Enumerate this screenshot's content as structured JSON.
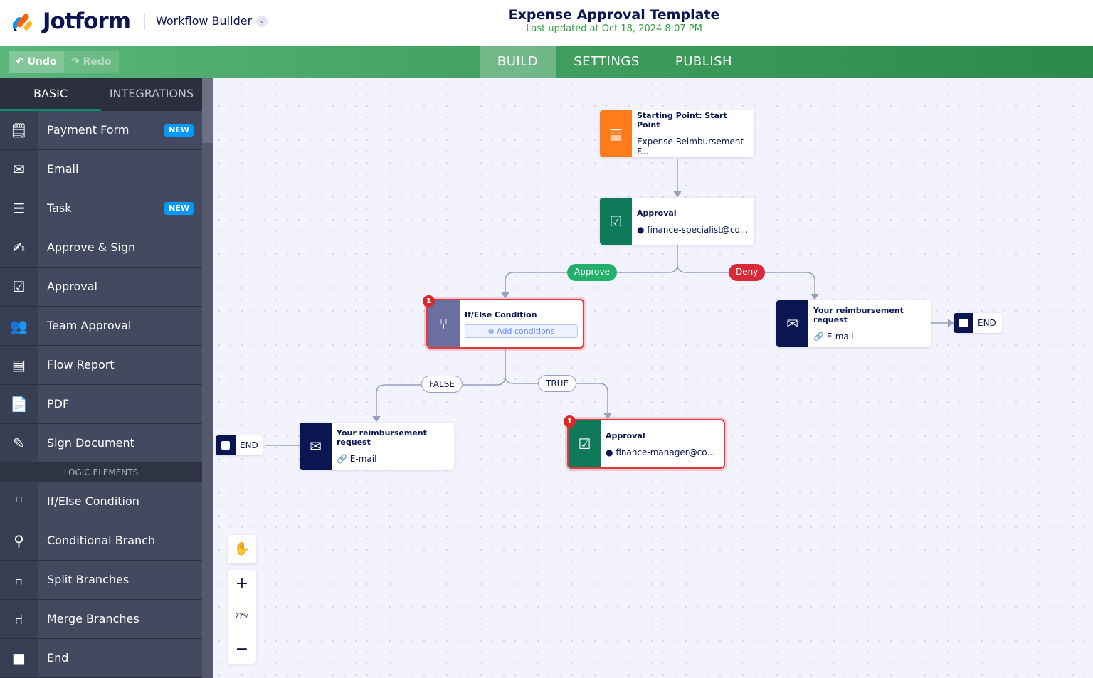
{
  "header": {
    "logo": "Jotform",
    "product": "Workflow Builder",
    "title": "Expense Approval Template",
    "updated": "Last updated at Oct 18, 2024 8:07 PM"
  },
  "toolbar": {
    "undo": "Undo",
    "redo": "Redo",
    "tabs": [
      "BUILD",
      "SETTINGS",
      "PUBLISH"
    ],
    "active_tab": "BUILD"
  },
  "sidebar": {
    "tabs": [
      "BASIC",
      "INTEGRATIONS"
    ],
    "active_tab": "BASIC",
    "items": [
      {
        "label": "Payment Form",
        "badge": "NEW",
        "icon": "payment-form-icon"
      },
      {
        "label": "Email",
        "icon": "email-icon"
      },
      {
        "label": "Task",
        "badge": "NEW",
        "icon": "task-icon"
      },
      {
        "label": "Approve & Sign",
        "icon": "approve-sign-icon"
      },
      {
        "label": "Approval",
        "icon": "approval-icon"
      },
      {
        "label": "Team Approval",
        "icon": "team-approval-icon"
      },
      {
        "label": "Flow Report",
        "icon": "flow-report-icon"
      },
      {
        "label": "PDF",
        "icon": "pdf-icon"
      },
      {
        "label": "Sign Document",
        "icon": "sign-document-icon"
      }
    ],
    "logic_header": "LOGIC ELEMENTS",
    "logic_items": [
      {
        "label": "If/Else Condition",
        "icon": "if-else-icon"
      },
      {
        "label": "Conditional Branch",
        "icon": "conditional-branch-icon"
      },
      {
        "label": "Split Branches",
        "icon": "split-branches-icon"
      },
      {
        "label": "Merge Branches",
        "icon": "merge-branches-icon"
      },
      {
        "label": "End",
        "icon": "end-icon"
      }
    ]
  },
  "canvas": {
    "start": {
      "title": "Starting Point: Start Point",
      "sub": "Expense Reimbursement F..."
    },
    "approval1": {
      "title": "Approval",
      "sub": "finance-specialist@co..."
    },
    "approve_label": "Approve",
    "deny_label": "Deny",
    "ifelse": {
      "title": "If/Else Condition",
      "action": "Add conditions",
      "badge": "1"
    },
    "email_deny": {
      "title": "Your reimbursement request",
      "sub": "E-mail"
    },
    "false_label": "FALSE",
    "true_label": "TRUE",
    "email_false": {
      "title": "Your reimbursement request",
      "sub": "E-mail"
    },
    "approval2": {
      "title": "Approval",
      "sub": "finance-manager@co...",
      "badge": "1"
    },
    "end_label": "END",
    "zoom": "77%"
  },
  "colors": {
    "green": "#3c9a5a",
    "navy": "#0a1551",
    "orange": "#ff7b1c",
    "teal": "#0e7a5a",
    "red": "#d92a2a",
    "purple": "#6b6fa0"
  }
}
